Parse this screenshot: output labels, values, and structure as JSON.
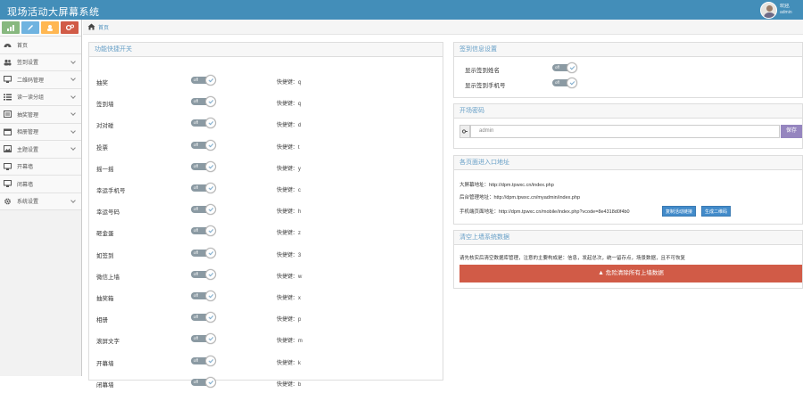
{
  "header": {
    "app_title": "现场活动大屏幕系统",
    "user_hello": "欢迎,",
    "user_name": "admin"
  },
  "breadcrumb": {
    "home": "首页"
  },
  "sidebar": {
    "items": [
      {
        "label": "首页",
        "icon": "dashboard-icon",
        "has_children": false
      },
      {
        "label": "签到设置",
        "icon": "users-icon",
        "has_children": true
      },
      {
        "label": "二维码管理",
        "icon": "desktop-icon",
        "has_children": true
      },
      {
        "label": "读一读分组",
        "icon": "list-icon",
        "has_children": true
      },
      {
        "label": "抽奖管理",
        "icon": "list-alt-icon",
        "has_children": true
      },
      {
        "label": "相册管理",
        "icon": "calendar-icon",
        "has_children": true
      },
      {
        "label": "主题设置",
        "icon": "picture-icon",
        "has_children": true
      },
      {
        "label": "开幕墙",
        "icon": "desktop-icon",
        "has_children": false
      },
      {
        "label": "闭幕墙",
        "icon": "desktop-icon",
        "has_children": false
      },
      {
        "label": "系统设置",
        "icon": "gear-icon",
        "has_children": true
      }
    ]
  },
  "switches_panel": {
    "title": "功能快捷开关",
    "toggle_text": "off",
    "rows": [
      {
        "name": "抽奖",
        "shortcut": "快捷键：q"
      },
      {
        "name": "签到墙",
        "shortcut": "快捷键：q"
      },
      {
        "name": "对对碰",
        "shortcut": "快捷键：d"
      },
      {
        "name": "投票",
        "shortcut": "快捷键：t"
      },
      {
        "name": "摇一摇",
        "shortcut": "快捷键：y"
      },
      {
        "name": "幸运手机号",
        "shortcut": "快捷键：c"
      },
      {
        "name": "幸运号码",
        "shortcut": "快捷键：h"
      },
      {
        "name": "砸金蛋",
        "shortcut": "快捷键：z"
      },
      {
        "name": "如签到",
        "shortcut": "快捷键：3"
      },
      {
        "name": "微信上墙",
        "shortcut": "快捷键：w"
      },
      {
        "name": "抽奖箱",
        "shortcut": "快捷键：x"
      },
      {
        "name": "相册",
        "shortcut": "快捷键：p"
      },
      {
        "name": "滚屏文字",
        "shortcut": "快捷键：m"
      },
      {
        "name": "开幕墙",
        "shortcut": "快捷键：k"
      },
      {
        "name": "闭幕墙",
        "shortcut": "快捷键：b"
      }
    ]
  },
  "signin_panel": {
    "title": "签到信息设置",
    "rows": [
      {
        "name": "显示签到姓名"
      },
      {
        "name": "显示签到手机号"
      }
    ],
    "toggle_text": "off"
  },
  "password_panel": {
    "title": "开场密码",
    "value": "admin",
    "button": "保存"
  },
  "entry_panel": {
    "title": "各页面进入口地址",
    "lines": [
      "大屏幕地址：http://dpm.tpwxc.cn/index.php",
      "后台管理地址：http://dpm.tpwxc.cn/myadmin/index.php",
      "手机端页面地址：http://dpm.tpwxc.cn/mobile/index.php?vcode=8e4318d0f4b0"
    ],
    "btn_copy": "复制活动链接",
    "btn_qr": "生成二维码"
  },
  "clear_panel": {
    "title": "清空上墙系统数据",
    "desc": "请先核实后清空数据库管理，注意的主要构成是：信息，发起总次，统一留存点，场景数据，且不可恢复",
    "button": "危险清除所有上墙数据"
  },
  "colors": {
    "topbar": "#438eb9",
    "danger": "#d15b47",
    "accent": "#428bca",
    "purple": "#9585bf"
  }
}
